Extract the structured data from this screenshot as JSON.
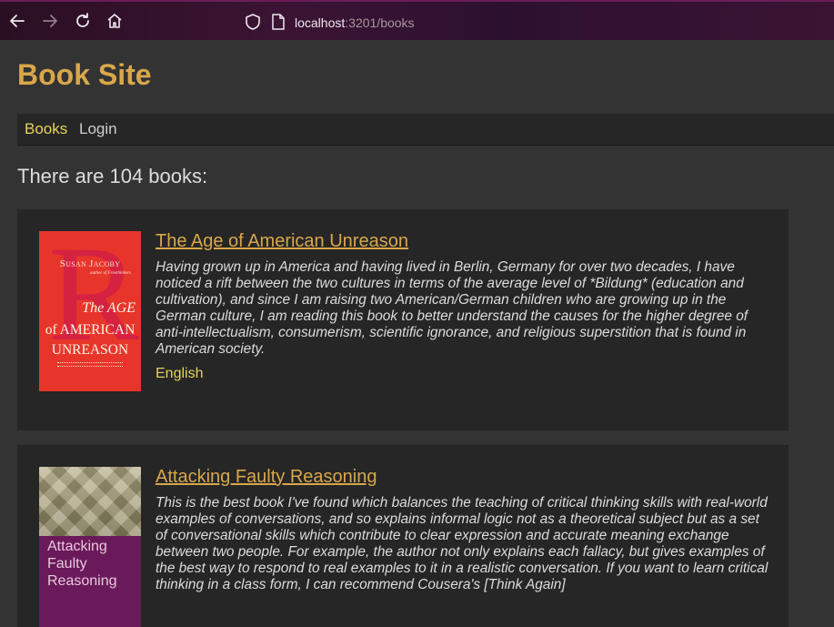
{
  "browser": {
    "url_host": "localhost",
    "url_path": ":3201/books"
  },
  "site": {
    "title": "Book Site",
    "nav": [
      "Books",
      "Login"
    ],
    "count_text": "There are 104 books:"
  },
  "books": [
    {
      "title": "The Age of American Unreason",
      "description": "Having grown up in America and having lived in Berlin, Germany for over two decades, I have noticed a rift between the two cultures in terms of the average level of *Bildung* (education and cultivation), and since I am raising two American/German children who are growing up in the German culture, I am reading this book to better understand the causes for the higher degree of anti-intellectualism, consumerism, scientific ignorance, and religious superstition that is found in American society.",
      "language": "English",
      "cover": {
        "author": "Susan Jacoby",
        "author_sub": "author of Freethinkers",
        "line1": "The AGE",
        "line2": "of AMERICAN",
        "line3": "UNREASON"
      }
    },
    {
      "title": "Attacking Faulty Reasoning",
      "description": "This is the best book I've found which balances the teaching of critical thinking skills with real-world examples of conversations, and so explains informal logic not as a theoretical subject but as a set of conversational skills which contribute to clear expression and accurate meaning exchange between two people. For example, the author not only explains each fallacy, but gives examples of the best way to respond to real examples to it in a realistic conversation. If you want to learn critical thinking in a class form, I can recommend Cousera's [Think Again]",
      "cover": {
        "title": "Attacking Faulty Reasoning"
      }
    }
  ]
}
